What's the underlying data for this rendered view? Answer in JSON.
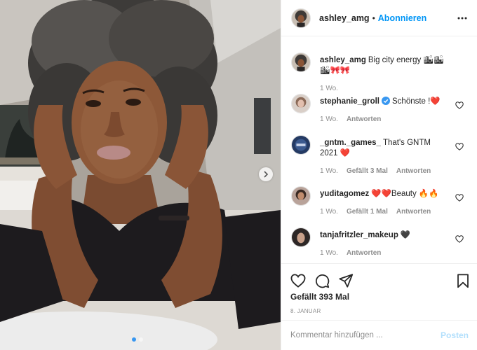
{
  "header": {
    "username": "ashley_amg",
    "separator": "•",
    "follow_label": "Abonnieren"
  },
  "caption": {
    "username": "ashley_amg",
    "text": "Big city energy 🏙🏙🏙🎀🎀",
    "time": "1 Wo."
  },
  "comments": [
    {
      "username": "stephanie_groll",
      "verified": true,
      "text": "Schönste !❤️",
      "time": "1 Wo.",
      "likes": "",
      "reply_label": "Antworten"
    },
    {
      "username": "_gntm._games_",
      "verified": false,
      "text": "That's GNTM 2021 ❤️",
      "time": "1 Wo.",
      "likes": "Gefällt 3 Mal",
      "reply_label": "Antworten"
    },
    {
      "username": "yuditagomez",
      "verified": false,
      "text": "❤️❤️Beauty 🔥🔥",
      "time": "1 Wo.",
      "likes": "Gefällt 1 Mal",
      "reply_label": "Antworten"
    },
    {
      "username": "tanjafritzler_makeup",
      "verified": false,
      "text": "🖤",
      "time": "1 Wo.",
      "likes": "",
      "reply_label": "Antworten"
    }
  ],
  "actions": {
    "icons": [
      "heart-icon",
      "comment-icon",
      "share-icon",
      "bookmark-icon"
    ],
    "likes": "Gefällt 393 Mal",
    "date": "8. JANUAR"
  },
  "add_comment": {
    "placeholder": "Kommentar hinzufügen ...",
    "post_label": "Posten"
  },
  "colors": {
    "accent": "#0095f6",
    "post_disabled": "#b2dffc",
    "like_red": "#ed4956",
    "muted_text": "#8e8e8e"
  }
}
